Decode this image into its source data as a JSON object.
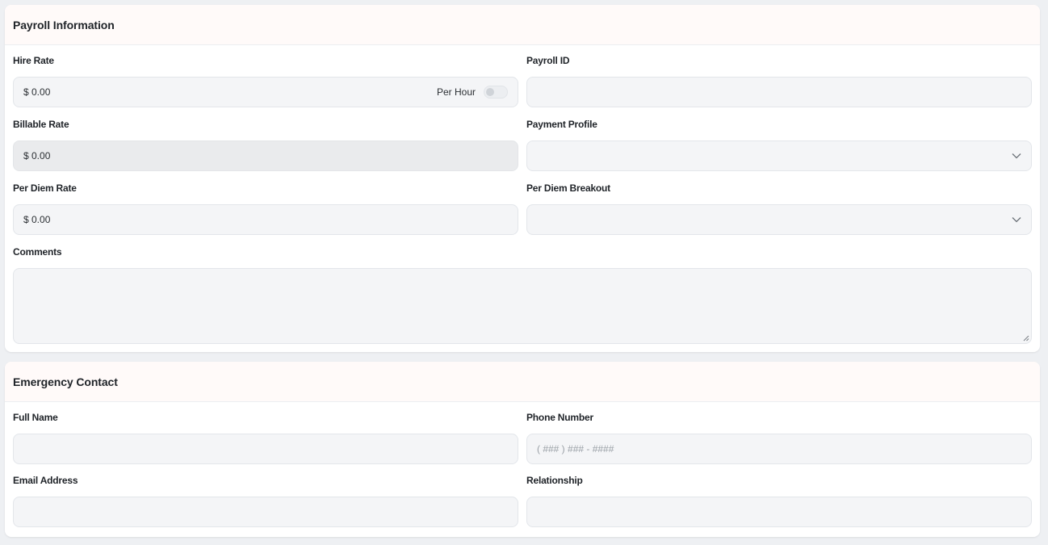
{
  "payroll": {
    "title": "Payroll Information",
    "hire_rate": {
      "label": "Hire Rate",
      "value": "$ 0.00",
      "toggle_label": "Per Hour",
      "toggle_on": false
    },
    "payroll_id": {
      "label": "Payroll ID",
      "value": ""
    },
    "billable_rate": {
      "label": "Billable Rate",
      "value": "$ 0.00"
    },
    "payment_profile": {
      "label": "Payment Profile",
      "value": ""
    },
    "per_diem_rate": {
      "label": "Per Diem Rate",
      "value": "$ 0.00"
    },
    "per_diem_breakout": {
      "label": "Per Diem Breakout",
      "value": ""
    },
    "comments": {
      "label": "Comments",
      "value": ""
    }
  },
  "emergency": {
    "title": "Emergency Contact",
    "full_name": {
      "label": "Full Name",
      "value": ""
    },
    "phone": {
      "label": "Phone Number",
      "placeholder": "( ### ) ### - ####"
    },
    "email": {
      "label": "Email Address",
      "value": ""
    },
    "relationship": {
      "label": "Relationship",
      "value": ""
    }
  },
  "icons": {
    "select": "chevron-down-icon",
    "resize": "resize-handle-icon"
  },
  "colors": {
    "header_bg": "#fffaf9",
    "field_bg": "#f4f5f7",
    "page_bg": "#eef0f3"
  }
}
